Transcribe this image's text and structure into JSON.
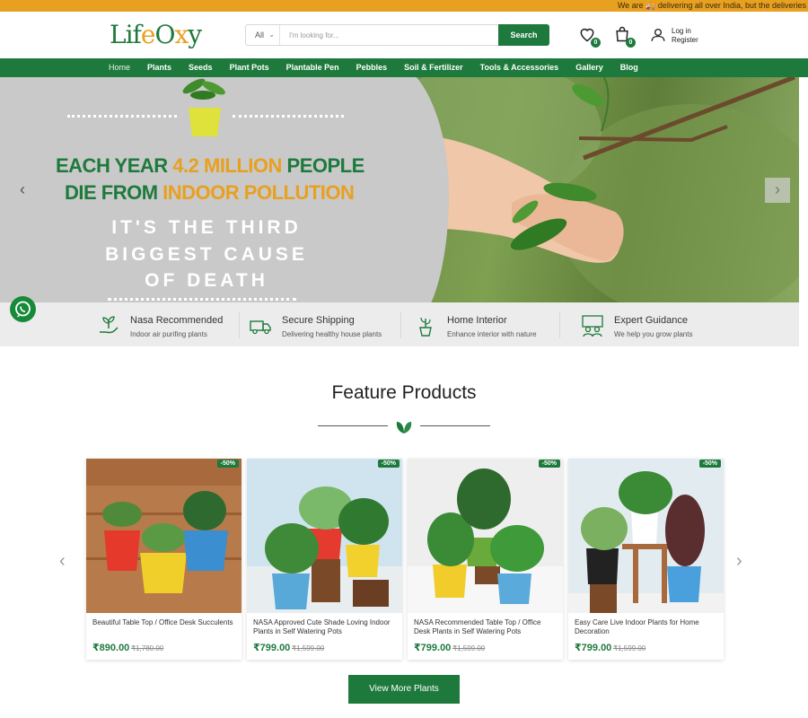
{
  "topbar": {
    "text": "We are 🚚 delivering all over India, but the deliveries"
  },
  "header": {
    "logo": "LifeOxy",
    "search": {
      "category": "All",
      "placeholder": "I'm looking for...",
      "button": "Search"
    },
    "wishlist_count": "0",
    "cart_count": "0",
    "account": {
      "login": "Log in",
      "register": "Register"
    }
  },
  "nav": [
    "Home",
    "Plants",
    "Seeds",
    "Plant Pots",
    "Plantable Pen",
    "Pebbles",
    "Soil & Fertilizer",
    "Tools & Accessories",
    "Gallery",
    "Blog"
  ],
  "hero": {
    "line1_a": "EACH YEAR ",
    "line1_b": "4.2 MILLION",
    "line1_c": " PEOPLE",
    "line2_a": "DIE FROM ",
    "line2_b": "INDOOR POLLUTION",
    "big1": "IT'S THE THIRD",
    "big2": "BIGGEST CAUSE",
    "big3": "OF DEATH"
  },
  "features": [
    {
      "title": "Nasa Recommended",
      "sub": "Indoor air purifing plants",
      "icon": "hand-plant-icon"
    },
    {
      "title": "Secure Shipping",
      "sub": "Delivering healthy house plants",
      "icon": "truck-icon"
    },
    {
      "title": "Home Interior",
      "sub": "Enhance interior with nature",
      "icon": "potted-plant-icon"
    },
    {
      "title": "Expert Guidance",
      "sub": "We help you grow plants",
      "icon": "expert-icon"
    }
  ],
  "section": {
    "title": "Feature Products"
  },
  "products": [
    {
      "name": "Beautiful Table Top / Office Desk Succulents",
      "price": "₹890.00",
      "old": "₹1,780.00",
      "discount": "-50%"
    },
    {
      "name": "NASA Approved Cute Shade Loving Indoor Plants in Self Watering Pots",
      "price": "₹799.00",
      "old": "₹1,599.00",
      "discount": "-50%"
    },
    {
      "name": "NASA Recommended Table Top / Office Desk Plants in Self Watering Pots",
      "price": "₹799.00",
      "old": "₹1,599.00",
      "discount": "-50%"
    },
    {
      "name": "Easy Care Live Indoor Plants for Home Decoration",
      "price": "₹799.00",
      "old": "₹1,599.00",
      "discount": "-50%"
    }
  ],
  "cta": {
    "label": "View More Plants"
  },
  "colors": {
    "brand": "#1e7a3c",
    "accent": "#e8a020"
  }
}
